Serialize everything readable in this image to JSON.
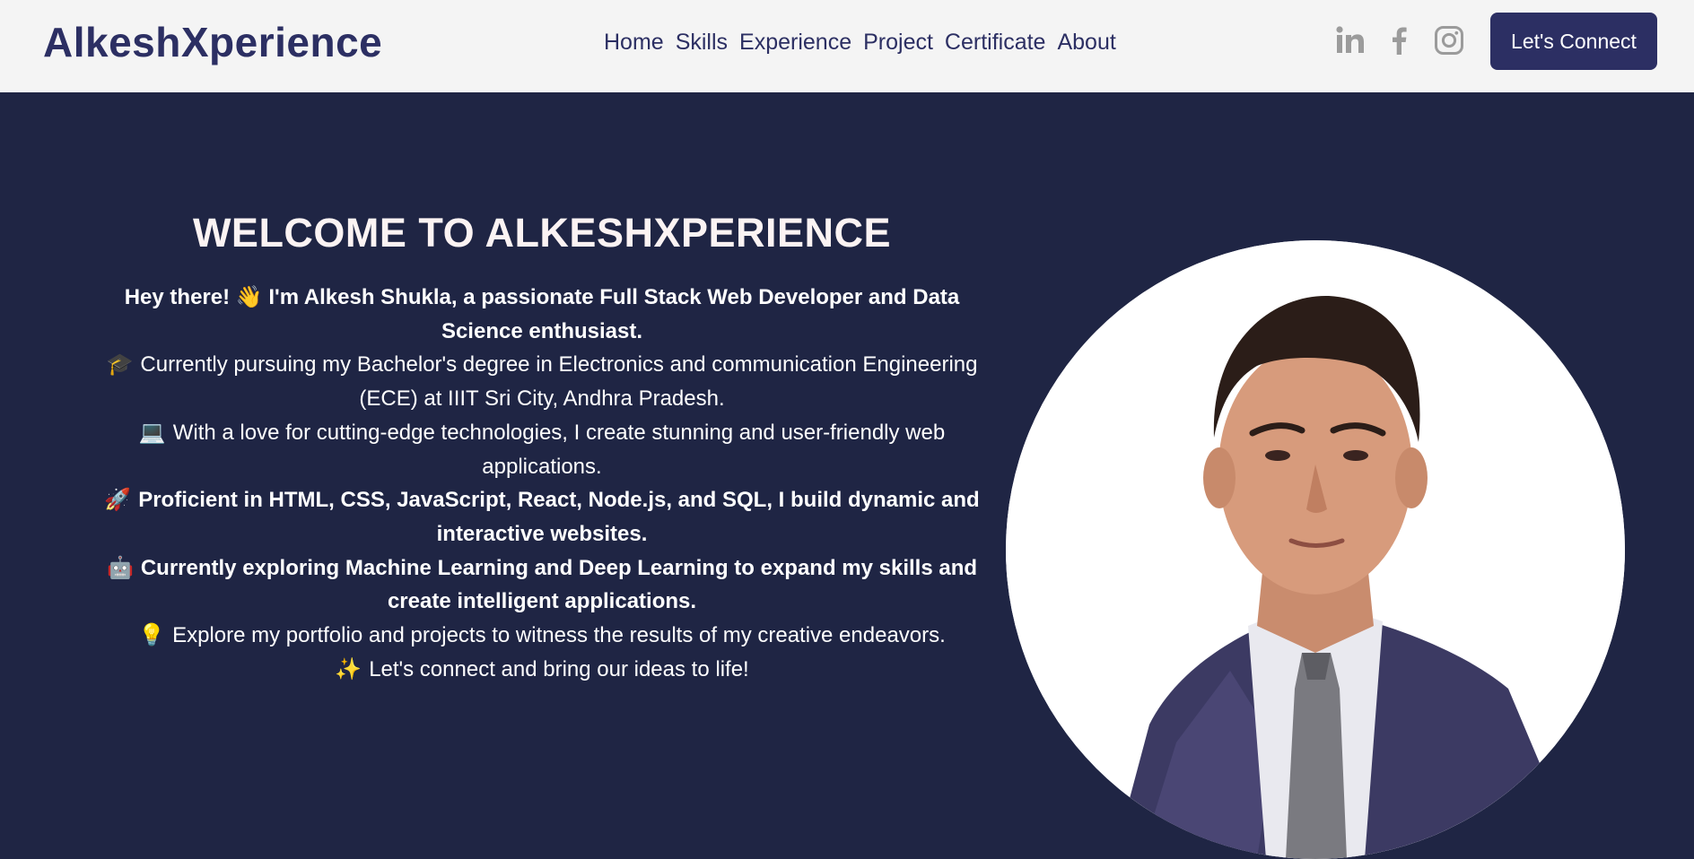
{
  "navbar": {
    "brand": "AlkeshXperience",
    "links": [
      "Home",
      "Skills",
      "Experience",
      "Project",
      "Certificate",
      "About"
    ],
    "socials": [
      "linkedin-icon",
      "facebook-icon",
      "instagram-icon"
    ],
    "connect_label": "Let's Connect"
  },
  "hero": {
    "title": "WELCOME TO ALKESHXPERIENCE",
    "lines": [
      {
        "emoji": "",
        "text": "Hey there! 👋 I'm Alkesh Shukla, a passionate Full Stack Web Developer and Data Science enthusiast."
      },
      {
        "emoji": "🎓",
        "text": "Currently pursuing my Bachelor's degree in Electronics and communication Engineering (ECE) at IIIT Sri City, Andhra Pradesh."
      },
      {
        "emoji": "💻",
        "text": "With a love for cutting-edge technologies, I create stunning and user-friendly web applications."
      },
      {
        "emoji": "🚀",
        "text": "Proficient in HTML, CSS, JavaScript, React, Node.js, and SQL, I build dynamic and interactive websites."
      },
      {
        "emoji": "🤖",
        "text": "Currently exploring Machine Learning and Deep Learning to expand my skills and create intelligent applications."
      },
      {
        "emoji": "💡",
        "text": "Explore my portfolio and projects to witness the results of my creative endeavors."
      },
      {
        "emoji": "✨",
        "text": "Let's connect and bring our ideas to life!"
      }
    ]
  },
  "colors": {
    "navbar_bg": "#f4f4f4",
    "brand": "#2c2f63",
    "hero_bg": "#1f2544",
    "button_bg": "#2c2f63"
  }
}
